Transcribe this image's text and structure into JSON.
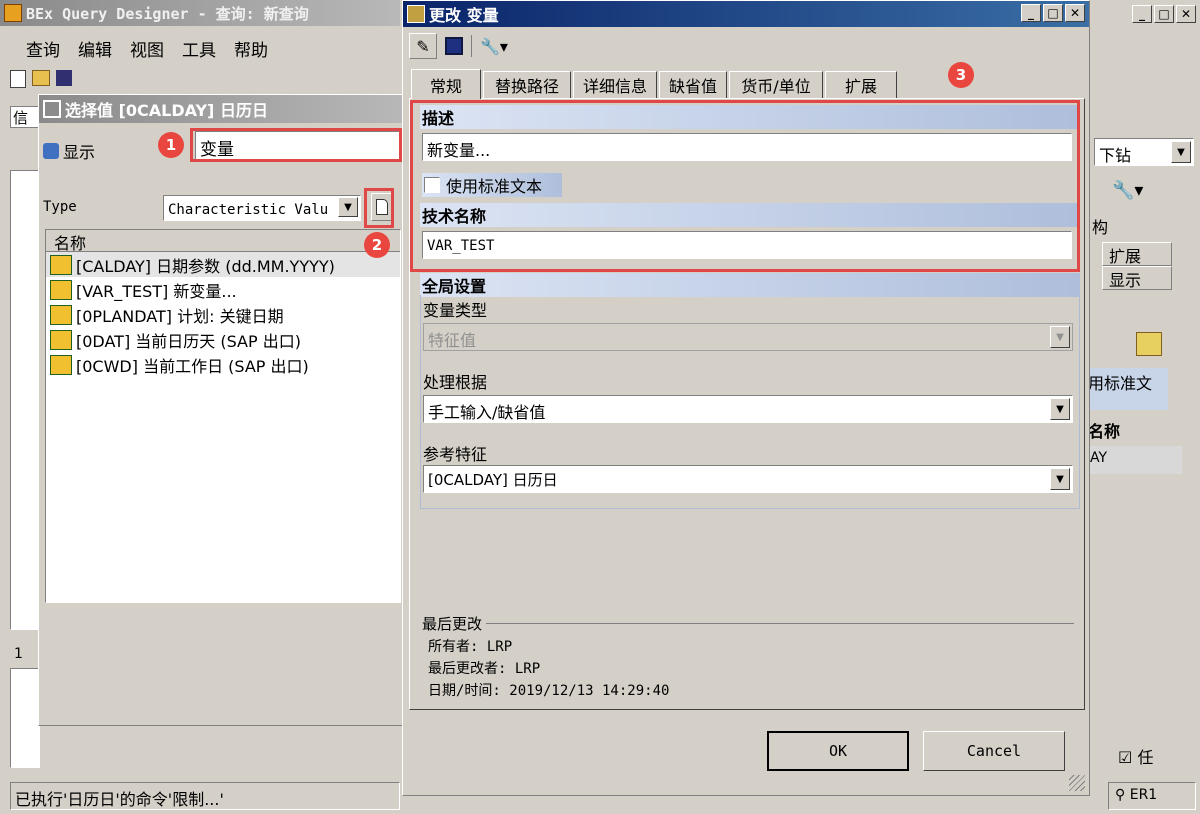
{
  "main_window": {
    "title": "BEx Query Designer - 查询: 新查询",
    "menu": [
      "查询",
      "编辑",
      "视图",
      "工具",
      "帮助"
    ],
    "left_tab": "信",
    "bottom_label": "1",
    "status_text": "已执行'日历日'的命令'限制...'",
    "status_right": "ER1"
  },
  "select_dialog": {
    "title": "选择值 [0CALDAY] 日历日",
    "display_label": "显示",
    "display_value": "变量",
    "type_label": "Type",
    "type_value": "Characteristic Valu",
    "list_header": "名称",
    "items": [
      "[CALDAY] 日期参数 (dd.MM.YYYY)",
      "[VAR_TEST] 新变量...",
      "[0PLANDAT] 计划: 关键日期",
      "[0DAT] 当前日历天 (SAP 出口)",
      "[0CWD] 当前工作日 (SAP 出口)"
    ]
  },
  "change_dialog": {
    "title": "更改 变量",
    "tabs": [
      "常规",
      "替换路径",
      "详细信息",
      "缺省值",
      "货币/单位",
      "扩展"
    ],
    "description_header": "描述",
    "description_value": "新变量...",
    "use_standard_text": "使用标准文本",
    "tech_name_header": "技术名称",
    "tech_name_value": "VAR_TEST",
    "global_settings_header": "全局设置",
    "var_type_label": "变量类型",
    "var_type_value": "特征值",
    "processing_label": "处理根据",
    "processing_value": "手工输入/缺省值",
    "ref_char_label": "参考特征",
    "ref_char_value": "[0CALDAY] 日历日",
    "last_changed_header": "最后更改",
    "owner": "所有者: LRP",
    "last_changed_by": "最后更改者: LRP",
    "datetime": "日期/时间: 2019/12/13 14:29:40",
    "ok_label": "OK",
    "cancel_label": "Cancel"
  },
  "right_window": {
    "drilldown": "下钻",
    "tab_struct": "构",
    "tab_extend": "扩展",
    "tab_display": "显示",
    "partial_use_std": "用标准文",
    "partial_tech": "名称",
    "partial_val": "AY",
    "bottom_tab": "任"
  },
  "annotations": [
    "1",
    "2",
    "3"
  ]
}
